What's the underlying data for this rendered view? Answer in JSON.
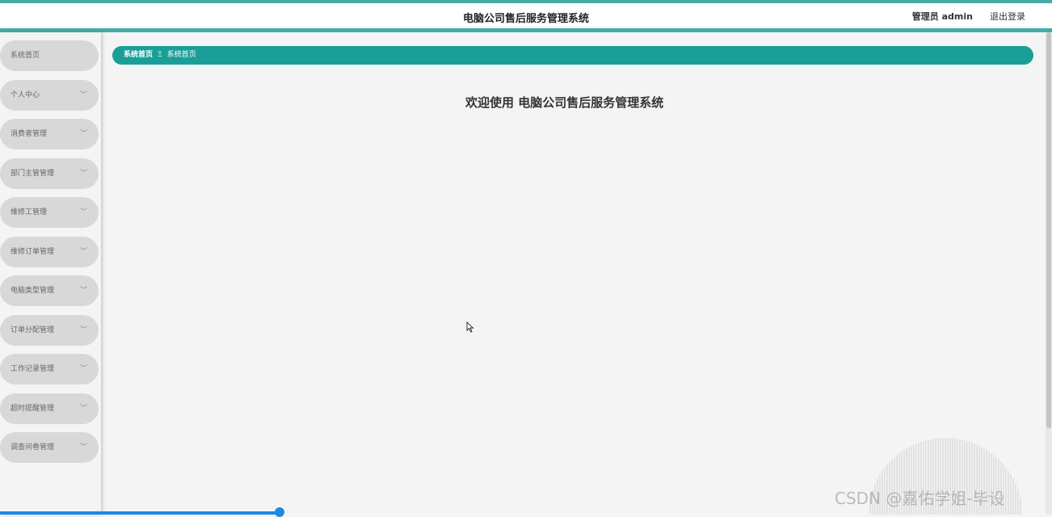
{
  "header": {
    "title": "电脑公司售后服务管理系统",
    "user_label": "管理员 admin",
    "logout_label": "退出登录"
  },
  "sidebar": {
    "items": [
      {
        "label": "系统首页",
        "has_submenu": false
      },
      {
        "label": "个人中心",
        "has_submenu": true
      },
      {
        "label": "消费者管理",
        "has_submenu": true
      },
      {
        "label": "部门主管管理",
        "has_submenu": true
      },
      {
        "label": "维修工管理",
        "has_submenu": true
      },
      {
        "label": "维修订单管理",
        "has_submenu": true
      },
      {
        "label": "电脑类型管理",
        "has_submenu": true
      },
      {
        "label": "订单分配管理",
        "has_submenu": true
      },
      {
        "label": "工作记录管理",
        "has_submenu": true
      },
      {
        "label": "超时提醒管理",
        "has_submenu": true
      },
      {
        "label": "调查问卷管理",
        "has_submenu": true
      }
    ],
    "chevron_icon": "chevron-down-icon"
  },
  "breadcrumb": {
    "first": "系统首页",
    "separator": "Ξ",
    "current": "系统首页"
  },
  "main": {
    "welcome": "欢迎使用 电脑公司售后服务管理系统"
  },
  "watermark": {
    "text": "CSDN @嘉佑学姐-毕设"
  },
  "progress": {
    "fraction": 0.266
  },
  "colors": {
    "accent": "#45ada8",
    "breadcrumb_bg": "#1a9f98",
    "menu_bg": "#d8d8d8",
    "progress": "#1e88e5"
  }
}
